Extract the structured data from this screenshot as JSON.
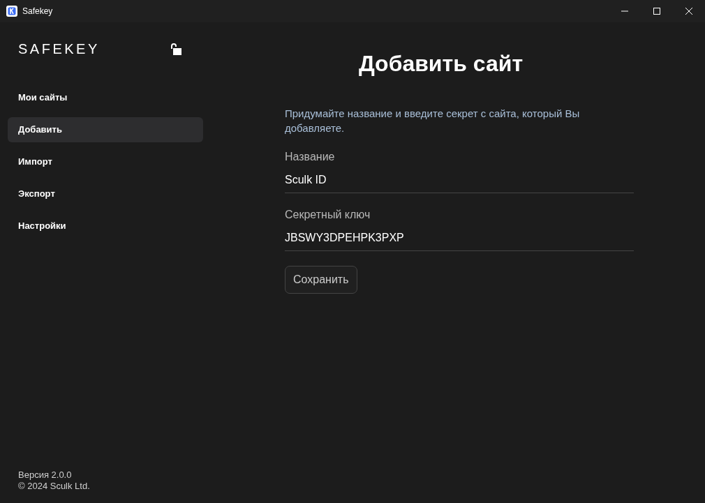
{
  "window": {
    "title": "Safekey"
  },
  "sidebar": {
    "logo": "SAFEKEY",
    "locked": false,
    "items": [
      {
        "label": "Мои сайты",
        "selected": false
      },
      {
        "label": "Добавить",
        "selected": true
      },
      {
        "label": "Импорт",
        "selected": false
      },
      {
        "label": "Экспорт",
        "selected": false
      },
      {
        "label": "Настройки",
        "selected": false
      }
    ],
    "version": "Версия 2.0.0",
    "copyright": "© 2024 Sculk Ltd."
  },
  "page": {
    "title": "Добавить сайт",
    "description": "Придумайте название и введите секрет с сайта, который Вы добавляете.",
    "fields": [
      {
        "label": "Название",
        "value": "Sculk ID"
      },
      {
        "label": "Секретный ключ",
        "value": "JBSWY3DPEHPK3PXP"
      }
    ],
    "button": "Сохранить"
  }
}
